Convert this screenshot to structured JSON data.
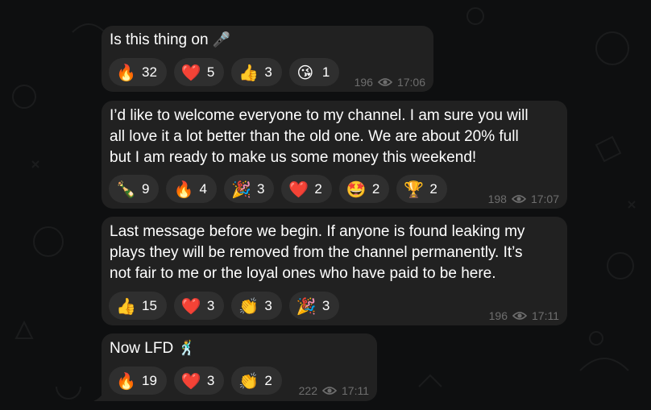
{
  "messages": [
    {
      "text": "Is this thing on",
      "trail_emoji": "🎤",
      "reactions": [
        {
          "emoji": "🔥",
          "icon": "fire-icon",
          "count": "32"
        },
        {
          "emoji": "❤️",
          "icon": "heart-icon",
          "count": "5"
        },
        {
          "emoji": "👍",
          "icon": "thumbs-up-icon",
          "count": "3"
        },
        {
          "emoji": "😘",
          "icon": "kiss-face-icon",
          "count": "1"
        }
      ],
      "views": "196",
      "time": "17:06"
    },
    {
      "text": "I’d like to welcome everyone to my channel. I am sure you will\nall love it a lot better than the old one. We are about 20% full\nbut I am ready to make us some money this weekend!",
      "reactions": [
        {
          "emoji": "🍾",
          "icon": "champagne-icon",
          "count": "9"
        },
        {
          "emoji": "🔥",
          "icon": "fire-icon",
          "count": "4"
        },
        {
          "emoji": "🎉",
          "icon": "party-popper-icon",
          "count": "3"
        },
        {
          "emoji": "❤️",
          "icon": "heart-icon",
          "count": "2"
        },
        {
          "emoji": "🤩",
          "icon": "star-struck-icon",
          "count": "2"
        },
        {
          "emoji": "🏆",
          "icon": "trophy-icon",
          "count": "2"
        }
      ],
      "views": "198",
      "time": "17:07"
    },
    {
      "text": "Last message before we begin. If anyone is found leaking my\nplays they will be removed from the channel permanently. It’s\nnot fair to me or the loyal ones who have paid to be here.",
      "reactions": [
        {
          "emoji": "👍",
          "icon": "thumbs-up-icon",
          "count": "15"
        },
        {
          "emoji": "❤️",
          "icon": "heart-icon",
          "count": "3"
        },
        {
          "emoji": "👏",
          "icon": "clapping-icon",
          "count": "3"
        },
        {
          "emoji": "🎉",
          "icon": "party-popper-icon",
          "count": "3"
        }
      ],
      "views": "196",
      "time": "17:11"
    },
    {
      "text": "Now LFD",
      "trail_emoji": "🕺",
      "reactions": [
        {
          "emoji": "🔥",
          "icon": "fire-icon",
          "count": "19"
        },
        {
          "emoji": "❤️",
          "icon": "heart-icon",
          "count": "3"
        },
        {
          "emoji": "👏",
          "icon": "clapping-icon",
          "count": "2"
        }
      ],
      "views": "222",
      "time": "17:11"
    }
  ],
  "colors": {
    "background": "#0e0f10",
    "bubble": "#212121",
    "chip": "#2f2f2f",
    "meta": "#6e6e6e"
  }
}
